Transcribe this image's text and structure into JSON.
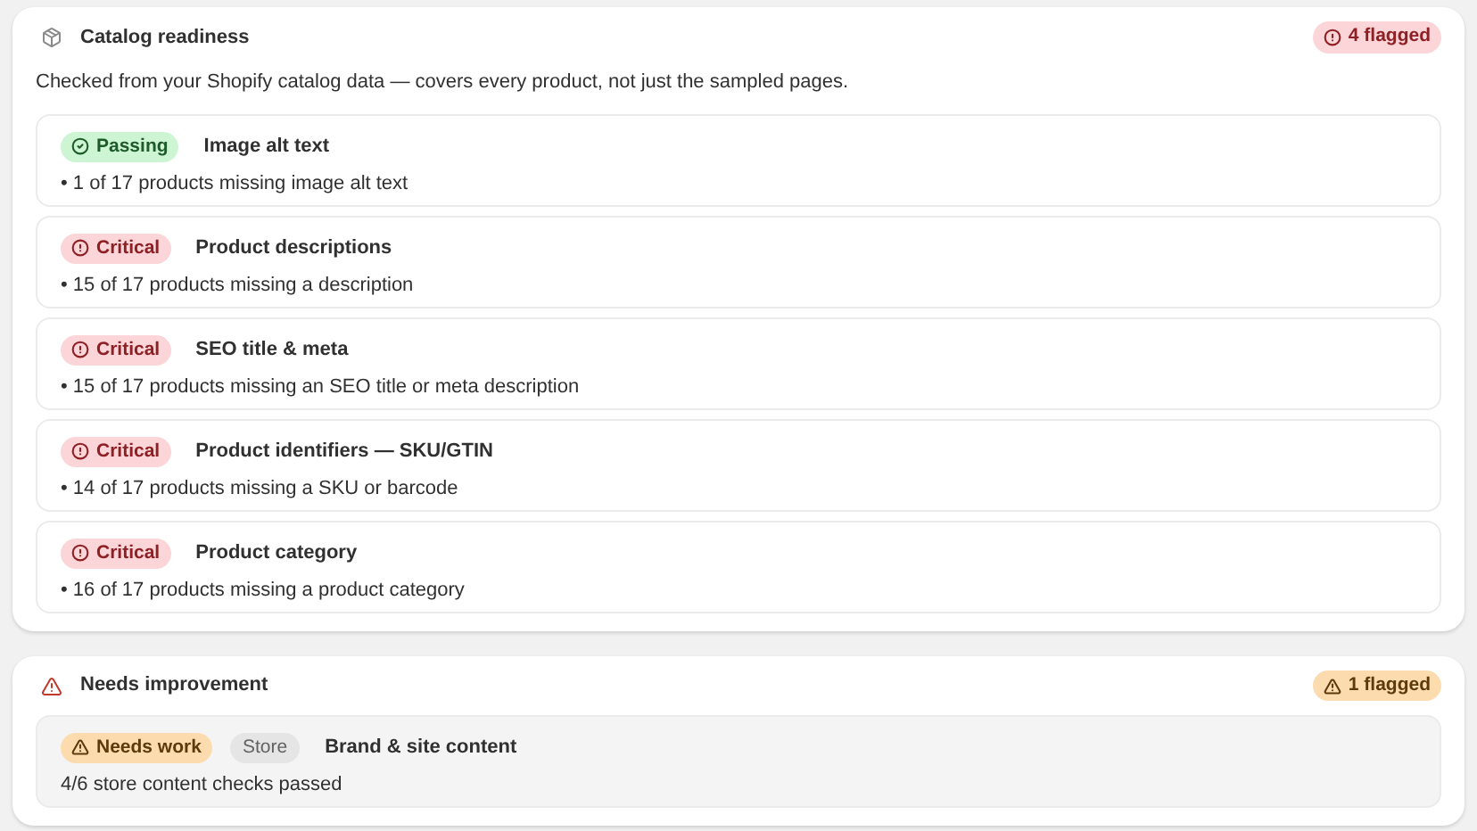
{
  "sections": [
    {
      "title": "Catalog readiness",
      "badge": {
        "text": "4 flagged",
        "kind": "critical"
      },
      "description": "Checked from your Shopify catalog data — covers every product, not just the sampled pages.",
      "items": [
        {
          "status": {
            "text": "Passing",
            "kind": "passing"
          },
          "title": "Image alt text",
          "detail": "• 1 of 17 products missing image alt text"
        },
        {
          "status": {
            "text": "Critical",
            "kind": "critical"
          },
          "title": "Product descriptions",
          "detail": "• 15 of 17 products missing a description"
        },
        {
          "status": {
            "text": "Critical",
            "kind": "critical"
          },
          "title": "SEO title & meta",
          "detail": "• 15 of 17 products missing an SEO title or meta description"
        },
        {
          "status": {
            "text": "Critical",
            "kind": "critical"
          },
          "title": "Product identifiers — SKU/GTIN",
          "detail": "• 14 of 17 products missing a SKU or barcode"
        },
        {
          "status": {
            "text": "Critical",
            "kind": "critical"
          },
          "title": "Product category",
          "detail": "• 16 of 17 products missing a product category"
        }
      ]
    },
    {
      "title": "Needs improvement",
      "badge": {
        "text": "1 flagged",
        "kind": "warning"
      },
      "items": [
        {
          "status": {
            "text": "Needs work",
            "kind": "warning"
          },
          "tag": "Store",
          "title": "Brand & site content",
          "detail": "4/6 store content checks passed"
        }
      ]
    }
  ]
}
